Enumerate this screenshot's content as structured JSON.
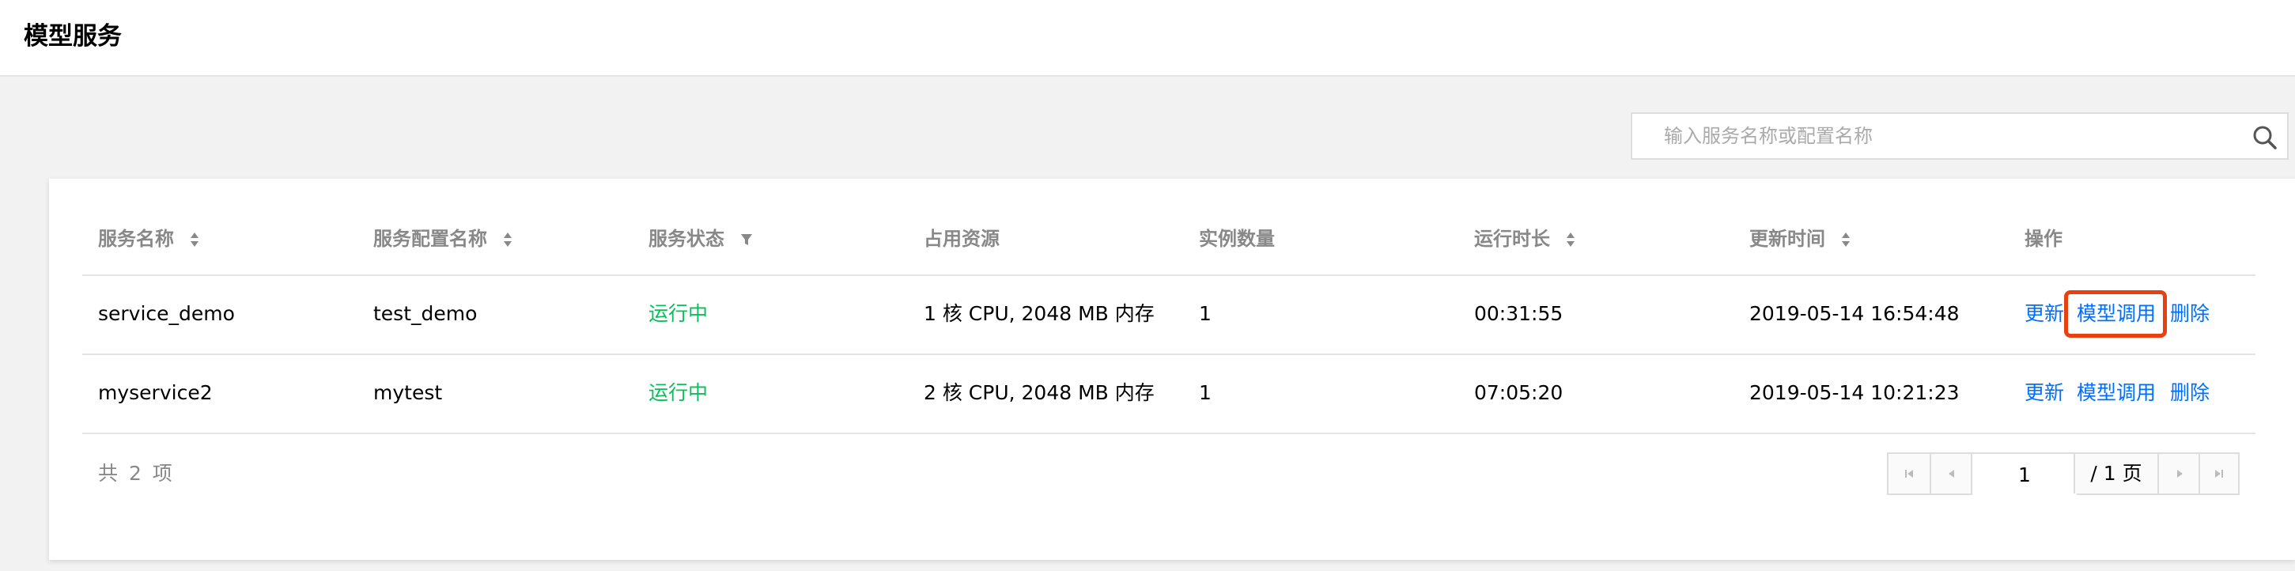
{
  "page": {
    "title": "模型服务"
  },
  "search": {
    "placeholder": "输入服务名称或配置名称"
  },
  "table": {
    "columns": [
      {
        "label": "服务名称",
        "sortable": true
      },
      {
        "label": "服务配置名称",
        "sortable": true
      },
      {
        "label": "服务状态",
        "filterable": true
      },
      {
        "label": "占用资源"
      },
      {
        "label": "实例数量"
      },
      {
        "label": "运行时长",
        "sortable": true
      },
      {
        "label": "更新时间",
        "sortable": true
      },
      {
        "label": "操作"
      }
    ],
    "rows": [
      {
        "name": "service_demo",
        "config": "test_demo",
        "status": "运行中",
        "resources": "1 核 CPU, 2048 MB 内存",
        "instances": "1",
        "duration": "00:31:55",
        "updated": "2019-05-14 16:54:48",
        "actions": {
          "update": "更新",
          "invoke": "模型调用",
          "delete": "删除"
        }
      },
      {
        "name": "myservice2",
        "config": "mytest",
        "status": "运行中",
        "resources": "2 核 CPU, 2048 MB 内存",
        "instances": "1",
        "duration": "07:05:20",
        "updated": "2019-05-14 10:21:23",
        "actions": {
          "update": "更新",
          "invoke": "模型调用",
          "delete": "删除"
        }
      }
    ]
  },
  "footer": {
    "total": "共 2 项",
    "pagination": {
      "current_page": "1",
      "total_pages": "/ 1 页"
    }
  },
  "colors": {
    "status_running": "#0abf5b",
    "link": "#006eff",
    "highlight": "#e8410f"
  },
  "icons": [
    "search-icon",
    "sort-icon",
    "filter-icon",
    "first-page-icon",
    "prev-page-icon",
    "next-page-icon",
    "last-page-icon"
  ]
}
